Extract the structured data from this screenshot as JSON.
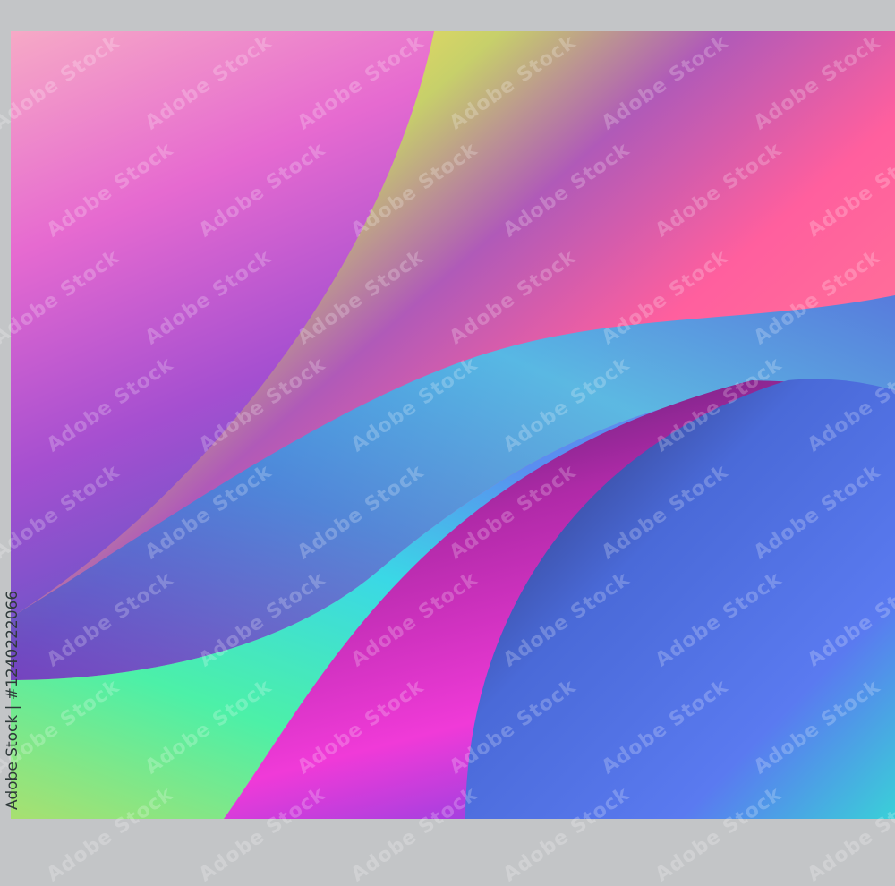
{
  "image": {
    "subject": "abstract holographic gradient waves",
    "watermark": "Adobe Stock",
    "credit": "Adobe Stock | #1240222066",
    "colors": {
      "frame": "#c3c5c7",
      "pink": "#f06ac8",
      "purple": "#8a4fd0",
      "yellow": "#ffe45a",
      "cyan": "#3ed8e8",
      "green": "#5ef0a0",
      "blue": "#4a6fe0",
      "magenta": "#e03ad0",
      "navy": "#2a2e6a"
    }
  }
}
